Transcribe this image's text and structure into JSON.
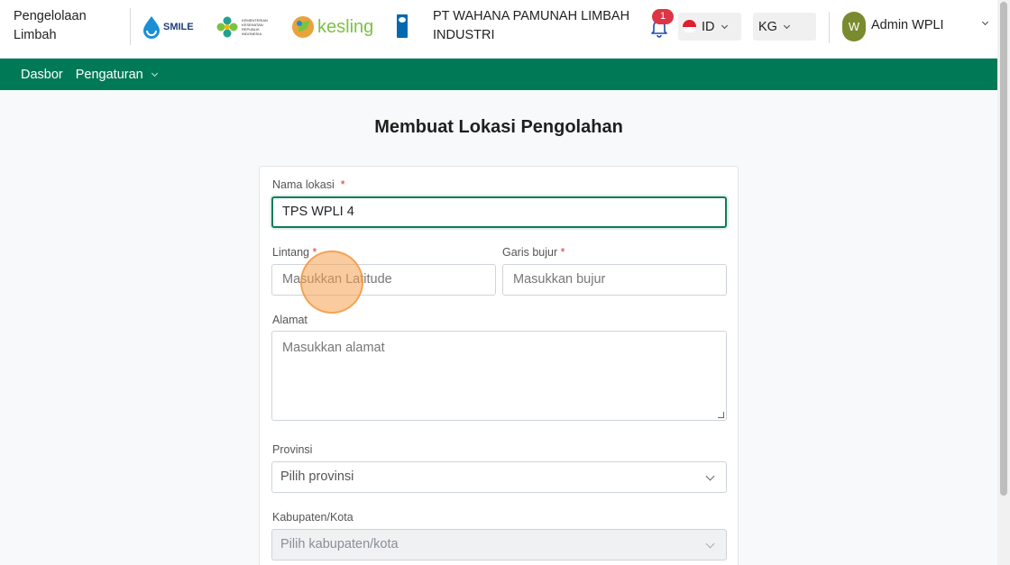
{
  "header": {
    "app_name": "Pengelolaan Limbah",
    "logos": {
      "smile": "SMILE",
      "kemenkes": "KEMENTERIAN KESEHATAN REPUBLIK INDONESIA",
      "kesling": "kesling"
    },
    "company_name": "PT WAHANA PAMUNAH LIMBAH INDUSTRI",
    "notification_count": "1",
    "language": "ID",
    "unit": "KG",
    "user": {
      "avatar_initial": "W",
      "name": "Admin WPLI"
    }
  },
  "nav": {
    "items": [
      {
        "label": "Dasbor"
      },
      {
        "label": "Pengaturan"
      }
    ]
  },
  "page": {
    "title": "Membuat Lokasi Pengolahan"
  },
  "form": {
    "location_name": {
      "label": "Nama lokasi",
      "required": "*",
      "value": "TPS WPLI 4"
    },
    "latitude": {
      "label": "Lintang",
      "required": "*",
      "placeholder": "Masukkan Latitude"
    },
    "longitude": {
      "label": "Garis bujur",
      "required": "*",
      "placeholder": "Masukkan bujur"
    },
    "address": {
      "label": "Alamat",
      "placeholder": "Masukkan alamat"
    },
    "province": {
      "label": "Provinsi",
      "placeholder": "Pilih provinsi"
    },
    "city": {
      "label": "Kabupaten/Kota",
      "placeholder": "Pilih kabupaten/kota"
    }
  },
  "colors": {
    "brand_green": "#007a56",
    "focus_border": "#0e7d55",
    "badge_red": "#dc3545",
    "avatar_olive": "#798b2e"
  }
}
